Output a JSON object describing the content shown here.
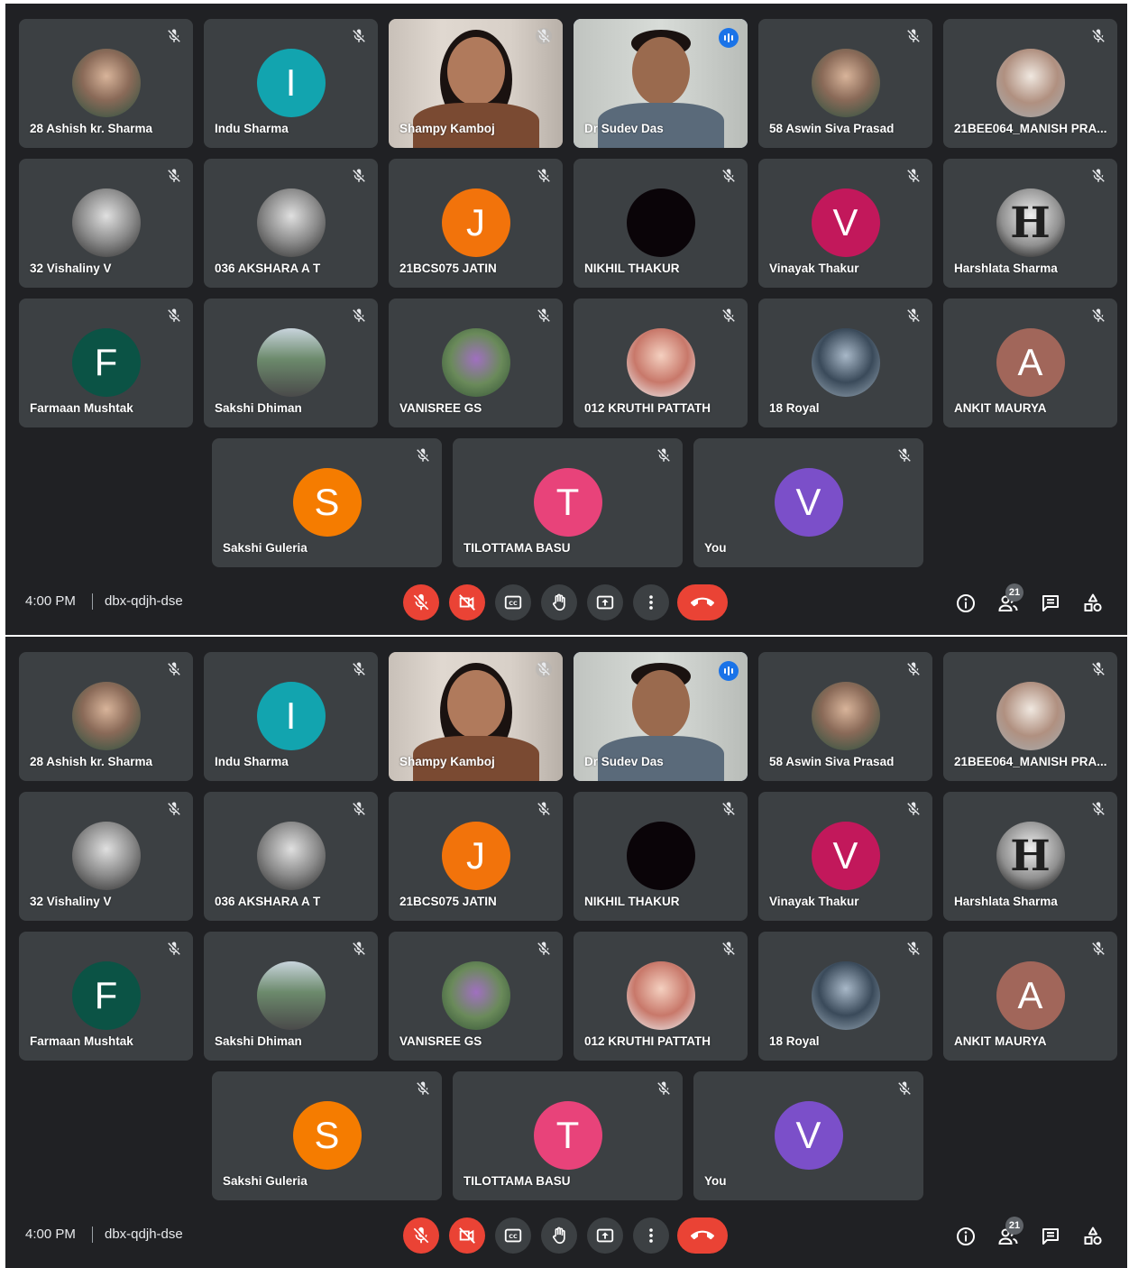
{
  "participants": [
    {
      "name": "28 Ashish kr. Sharma",
      "avatar": "photo",
      "initial": ""
    },
    {
      "name": "Indu Sharma",
      "avatar": "initial",
      "initial": "I",
      "color": "#12a4af"
    },
    {
      "name": "Shampy Kamboj",
      "avatar": "video",
      "initial": ""
    },
    {
      "name": "Dr Sudev Das",
      "avatar": "video",
      "initial": ""
    },
    {
      "name": "58 Aswin Siva Prasad",
      "avatar": "photo",
      "initial": ""
    },
    {
      "name": "21BEE064_MANISH PRA...",
      "avatar": "photo",
      "initial": ""
    },
    {
      "name": "32 Vishaliny V",
      "avatar": "photo",
      "initial": ""
    },
    {
      "name": "036 AKSHARA A T",
      "avatar": "photo",
      "initial": ""
    },
    {
      "name": "21BCS075 JATIN",
      "avatar": "initial",
      "initial": "J",
      "color": "#f2730b"
    },
    {
      "name": "NIKHIL THAKUR",
      "avatar": "photo",
      "initial": ""
    },
    {
      "name": "Vinayak Thakur",
      "avatar": "initial",
      "initial": "V",
      "color": "#c2185b"
    },
    {
      "name": "Harshlata Sharma",
      "avatar": "photo",
      "initial": "H"
    },
    {
      "name": "Farmaan Mushtak",
      "avatar": "initial",
      "initial": "F",
      "color": "#0b5345"
    },
    {
      "name": "Sakshi Dhiman",
      "avatar": "photo",
      "initial": ""
    },
    {
      "name": "VANISREE GS",
      "avatar": "photo",
      "initial": ""
    },
    {
      "name": "012 KRUTHI PATTATH",
      "avatar": "photo",
      "initial": ""
    },
    {
      "name": "18 Royal",
      "avatar": "photo",
      "initial": ""
    },
    {
      "name": "ANKIT MAURYA",
      "avatar": "initial",
      "initial": "A",
      "color": "#a1665a"
    },
    {
      "name": "Sakshi Guleria",
      "avatar": "initial",
      "initial": "S",
      "color": "#f57c00"
    },
    {
      "name": "TILOTTAMA BASU",
      "avatar": "initial",
      "initial": "T",
      "color": "#e8437a"
    },
    {
      "name": "You",
      "avatar": "initial",
      "initial": "V",
      "color": "#7b4fc9"
    }
  ],
  "meeting": {
    "time": "4:00 PM",
    "code": "dbx-qdjh-dse",
    "participant_count": "21"
  },
  "colors": {
    "background": "#202124",
    "tile": "#3c4043",
    "danger": "#ea4335",
    "active_speaker": "#8ab4f8"
  },
  "controls": [
    "mic-off-icon",
    "camera-off-icon",
    "captions-icon",
    "raise-hand-icon",
    "present-icon",
    "more-options-icon",
    "leave-call-icon"
  ],
  "side_controls": [
    "info-icon",
    "people-icon",
    "chat-icon",
    "activities-icon"
  ]
}
